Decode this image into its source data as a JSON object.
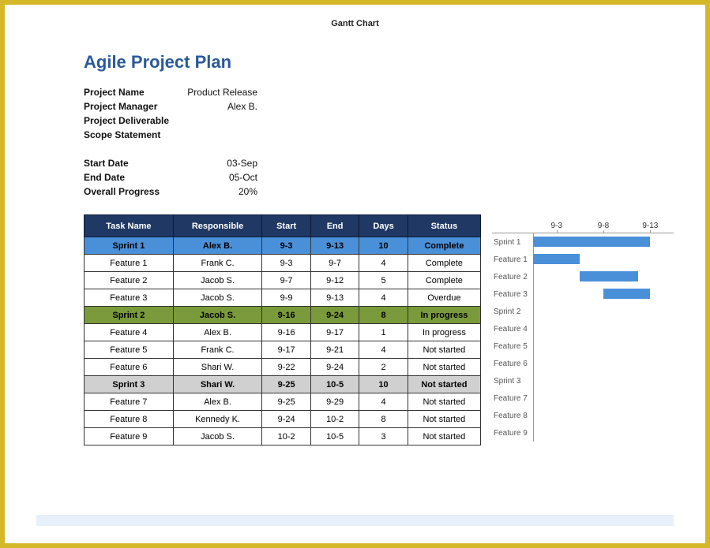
{
  "page_header": "Gantt Chart",
  "project_title": "Agile Project Plan",
  "meta": {
    "project_name_label": "Project Name",
    "project_name_value": "Product Release",
    "project_manager_label": "Project Manager",
    "project_manager_value": "Alex B.",
    "deliverable_label": "Project Deliverable",
    "deliverable_value": "",
    "scope_label": "Scope Statement",
    "scope_value": "",
    "start_label": "Start Date",
    "start_value": "03-Sep",
    "end_label": "End Date",
    "end_value": "05-Oct",
    "progress_label": "Overall Progress",
    "progress_value": "20%"
  },
  "table": {
    "headers": {
      "task": "Task Name",
      "responsible": "Responsible",
      "start": "Start",
      "end": "End",
      "days": "Days",
      "status": "Status"
    },
    "rows": [
      {
        "task": "Sprint 1",
        "responsible": "Alex B.",
        "start": "9-3",
        "end": "9-13",
        "days": "10",
        "status": "Complete",
        "group": "a"
      },
      {
        "task": "Feature 1",
        "responsible": "Frank C.",
        "start": "9-3",
        "end": "9-7",
        "days": "4",
        "status": "Complete"
      },
      {
        "task": "Feature 2",
        "responsible": "Jacob S.",
        "start": "9-7",
        "end": "9-12",
        "days": "5",
        "status": "Complete"
      },
      {
        "task": "Feature 3",
        "responsible": "Jacob S.",
        "start": "9-9",
        "end": "9-13",
        "days": "4",
        "status": "Overdue"
      },
      {
        "task": "Sprint 2",
        "responsible": "Jacob S.",
        "start": "9-16",
        "end": "9-24",
        "days": "8",
        "status": "In progress",
        "group": "b"
      },
      {
        "task": "Feature 4",
        "responsible": "Alex B.",
        "start": "9-16",
        "end": "9-17",
        "days": "1",
        "status": "In progress"
      },
      {
        "task": "Feature 5",
        "responsible": "Frank C.",
        "start": "9-17",
        "end": "9-21",
        "days": "4",
        "status": "Not started"
      },
      {
        "task": "Feature 6",
        "responsible": "Shari W.",
        "start": "9-22",
        "end": "9-24",
        "days": "2",
        "status": "Not started"
      },
      {
        "task": "Sprint 3",
        "responsible": "Shari W.",
        "start": "9-25",
        "end": "10-5",
        "days": "10",
        "status": "Not started",
        "group": "c"
      },
      {
        "task": "Feature 7",
        "responsible": "Alex B.",
        "start": "9-25",
        "end": "9-29",
        "days": "4",
        "status": "Not started"
      },
      {
        "task": "Feature 8",
        "responsible": "Kennedy K.",
        "start": "9-24",
        "end": "10-2",
        "days": "8",
        "status": "Not started"
      },
      {
        "task": "Feature 9",
        "responsible": "Jacob S.",
        "start": "10-2",
        "end": "10-5",
        "days": "3",
        "status": "Not started"
      }
    ]
  },
  "chart_data": {
    "type": "bar",
    "title": "",
    "xlabel": "",
    "ylabel": "",
    "x_ticks": [
      "9-3",
      "9-8",
      "9-13"
    ],
    "x_range": [
      3,
      15
    ],
    "categories": [
      "Sprint 1",
      "Feature 1",
      "Feature 2",
      "Feature 3",
      "Sprint 2",
      "Feature 4",
      "Feature 5",
      "Feature 6",
      "Sprint 3",
      "Feature 7",
      "Feature 8",
      "Feature 9"
    ],
    "bars": [
      {
        "label": "Sprint 1",
        "start": 3,
        "end": 13
      },
      {
        "label": "Feature 1",
        "start": 3,
        "end": 7
      },
      {
        "label": "Feature 2",
        "start": 7,
        "end": 12
      },
      {
        "label": "Feature 3",
        "start": 9,
        "end": 13
      },
      {
        "label": "Sprint 2",
        "start": null,
        "end": null
      },
      {
        "label": "Feature 4",
        "start": null,
        "end": null
      },
      {
        "label": "Feature 5",
        "start": null,
        "end": null
      },
      {
        "label": "Feature 6",
        "start": null,
        "end": null
      },
      {
        "label": "Sprint 3",
        "start": null,
        "end": null
      },
      {
        "label": "Feature 7",
        "start": null,
        "end": null
      },
      {
        "label": "Feature 8",
        "start": null,
        "end": null
      },
      {
        "label": "Feature 9",
        "start": null,
        "end": null
      }
    ]
  }
}
